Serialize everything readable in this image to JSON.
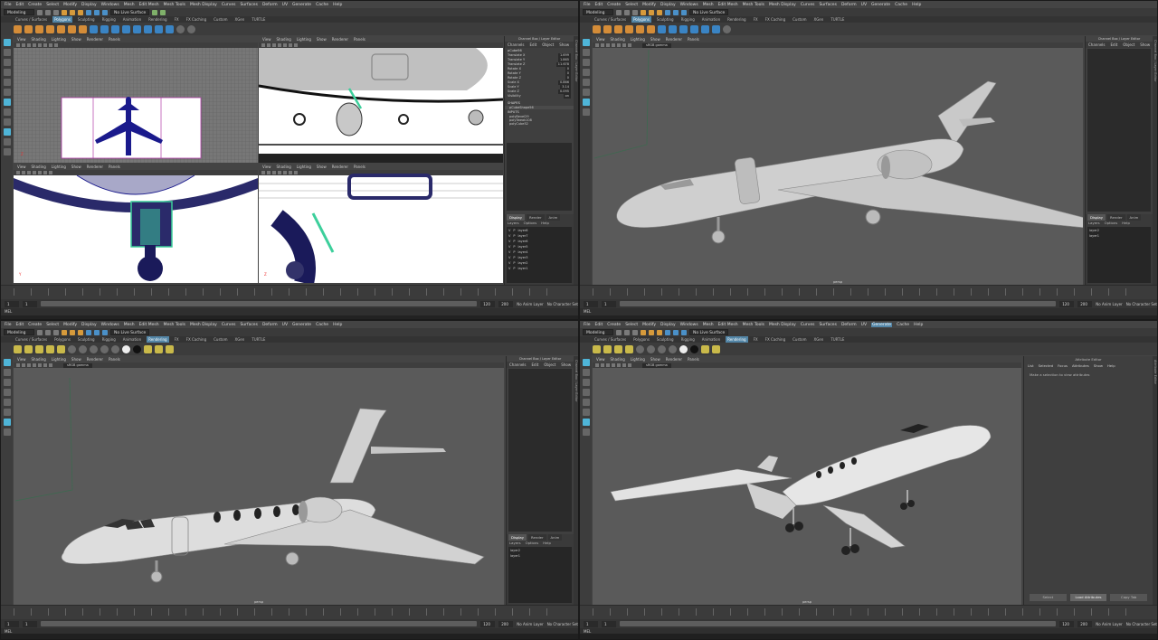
{
  "menu": [
    "File",
    "Edit",
    "Create",
    "Select",
    "Modify",
    "Display",
    "Windows",
    "Mesh",
    "Edit Mesh",
    "Mesh Tools",
    "Mesh Display",
    "Curves",
    "Surfaces",
    "Deform",
    "UV",
    "Generate",
    "Cache",
    "Help"
  ],
  "menu_q4_rendering_extra": "Rendering",
  "status": {
    "mode": "Modeling",
    "live_surface": "No Live Surface"
  },
  "shelf_tabs": [
    "Curves / Surfaces",
    "Polygons",
    "Sculpting",
    "Rigging",
    "Animation",
    "Rendering",
    "FX",
    "FX Caching",
    "Custom",
    "XGen",
    "TURTLE"
  ],
  "viewport_menu": [
    "View",
    "Shading",
    "Lighting",
    "Show",
    "Renderer",
    "Panels"
  ],
  "viewport": {
    "camera": "persp",
    "colorspace": "sRGB gamma",
    "gamma": "1.00",
    "exposure": "0.00",
    "axis": "Z"
  },
  "channel_box": {
    "title": "Channel Box / Layer Editor",
    "menus": [
      "Channels",
      "Edit",
      "Object",
      "Show"
    ],
    "object": "pCube56",
    "attrs": [
      {
        "name": "Translate X",
        "value": "1.699"
      },
      {
        "name": "Translate Y",
        "value": "1.865"
      },
      {
        "name": "Translate Z",
        "value": "11.678"
      },
      {
        "name": "Rotate X",
        "value": "0"
      },
      {
        "name": "Rotate Y",
        "value": "0"
      },
      {
        "name": "Rotate Z",
        "value": "0"
      },
      {
        "name": "Scale X",
        "value": "0.866"
      },
      {
        "name": "Scale Y",
        "value": "3.14"
      },
      {
        "name": "Scale Z",
        "value": "0.095"
      },
      {
        "name": "Visibility",
        "value": "on"
      }
    ],
    "shapes_label": "SHAPES",
    "shape": "pCubeShape56",
    "inputs_label": "INPUTS",
    "inputs": [
      "polyBevel29",
      "polyTweak108",
      "polyCube52"
    ]
  },
  "layer_editor": {
    "tabs": [
      "Display",
      "Render",
      "Anim"
    ],
    "sub_menus": [
      "Layers",
      "Options",
      "Help"
    ],
    "layers_q1": [
      "layer8",
      "layer7",
      "layer6",
      "layer5",
      "layer4",
      "layer3",
      "layer2",
      "layer1"
    ],
    "layers_small": [
      "layer2",
      "layer1"
    ],
    "layer_flags": [
      "V",
      "P"
    ]
  },
  "side_tabs": [
    "Channel Box / Layer Editor",
    "Modeling Toolkit",
    "Attribute Editor"
  ],
  "range": {
    "start": "1",
    "start2": "1",
    "end": "120",
    "end2": "120",
    "max": "200",
    "anim_layer": "No Anim Layer",
    "char_set": "No Character Set",
    "current": "1"
  },
  "command_line": "MEL",
  "attribute_editor": {
    "title": "Attribute Editor",
    "menus": [
      "List",
      "Selected",
      "Focus",
      "Attributes",
      "Show",
      "Help"
    ],
    "message": "Make a selection to view attributes",
    "buttons": [
      "Select",
      "Load Attributes",
      "Copy Tab"
    ]
  },
  "q4_title": "Autodesk Maya - Not Saved - Select an object",
  "colors": {
    "accent": "#5285a6",
    "panel": "#444444",
    "viewport": "#5a5a5a",
    "plane": "#c8c8c8",
    "ortho_bg": "#ffffff",
    "wire": "#1a1a8c",
    "selection": "#3ccf9b"
  }
}
